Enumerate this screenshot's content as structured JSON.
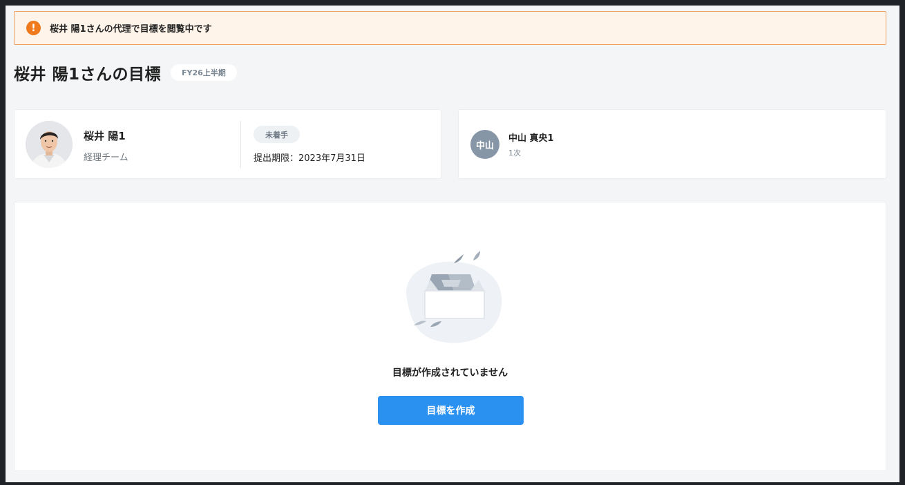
{
  "alert": {
    "icon": "exclamation-icon",
    "icon_glyph": "!",
    "text": "桜井 陽1さんの代理で目標を閲覧中です",
    "accent_color": "#ef7a1e"
  },
  "page": {
    "title": "桜井 陽1さんの目標",
    "period": "FY26上半期"
  },
  "employee": {
    "name": "桜井 陽1",
    "team": "経理チーム",
    "status": "未着手",
    "deadline": "提出期限：2023年7月31日"
  },
  "evaluator": {
    "avatar_text": "中山",
    "name": "中山 真央1",
    "level": "1次"
  },
  "goals": {
    "empty_icon": "empty-box-icon",
    "empty_message": "目標が作成されていません",
    "create_button": "目標を作成",
    "button_color": "#2a91f0"
  }
}
